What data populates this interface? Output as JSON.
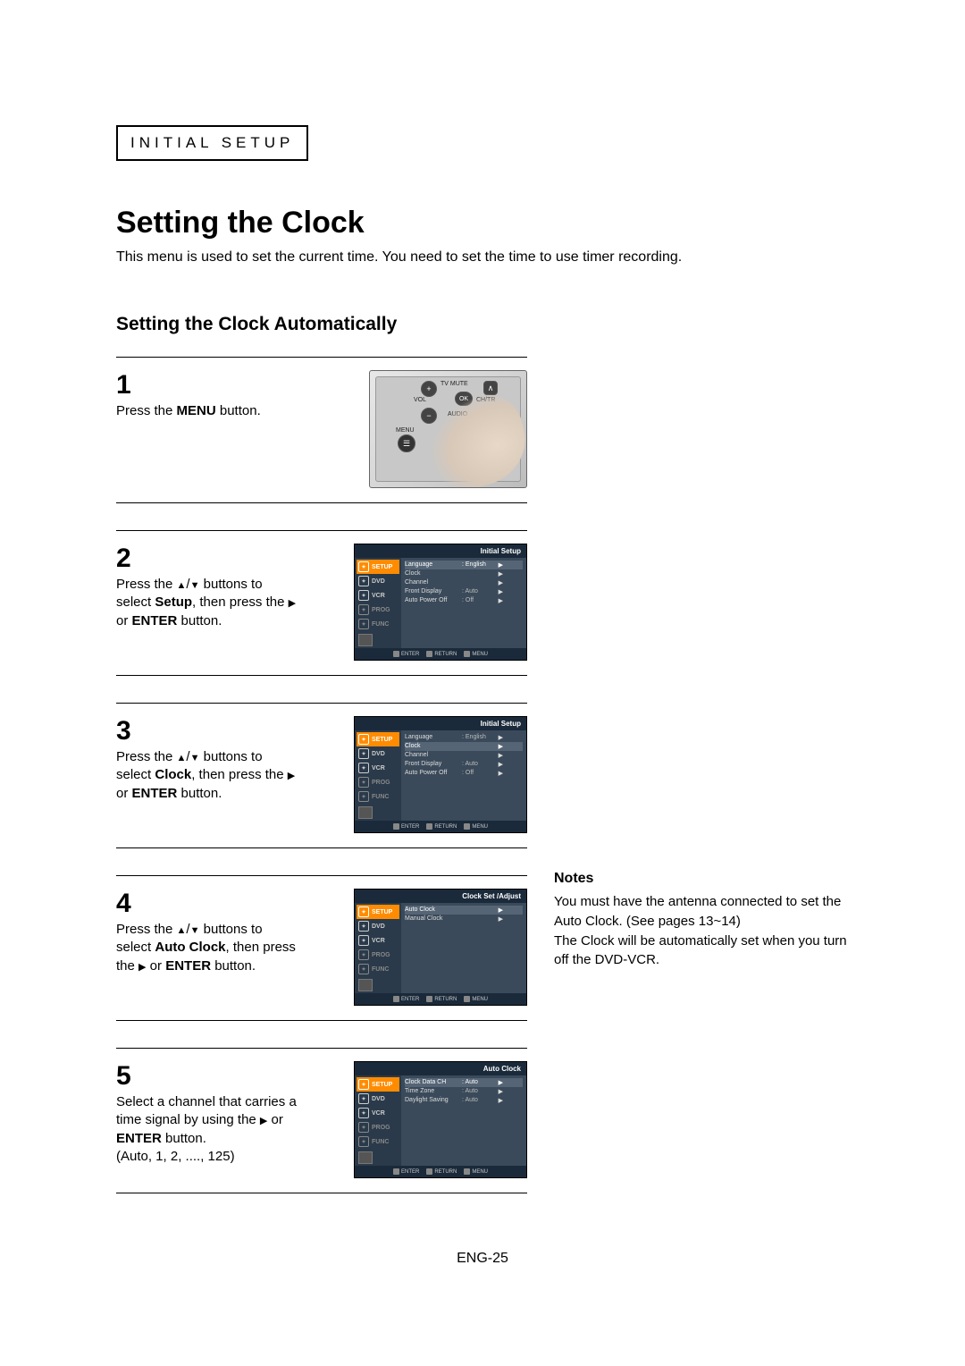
{
  "section_label": "INITIAL SETUP",
  "main_title": "Setting the Clock",
  "intro": "This menu is used to set the current time. You need to set the time to use timer recording.",
  "sub_title": "Setting the Clock Automatically",
  "steps": {
    "s1": {
      "num": "1",
      "text_before": "Press the ",
      "bold": "MENU",
      "text_after": " button."
    },
    "s2": {
      "num": "2",
      "line1_a": "Press the ",
      "line1_b": " buttons to",
      "line2_a": "select ",
      "line2_bold": "Setup",
      "line2_b": ", then press the ",
      "line3_a": "or ",
      "line3_bold": "ENTER",
      "line3_b": " button."
    },
    "s3": {
      "num": "3",
      "line1_a": "Press the ",
      "line1_b": " buttons to",
      "line2_a": "select ",
      "line2_bold": "Clock",
      "line2_b": ", then press the ",
      "line3_a": "or ",
      "line3_bold": "ENTER",
      "line3_b": " button."
    },
    "s4": {
      "num": "4",
      "line1_a": "Press the ",
      "line1_b": " buttons to",
      "line2_a": "select ",
      "line2_bold": "Auto Clock",
      "line2_b": ", then press",
      "line3_a": "the ",
      "line3_b": " or ",
      "line3_bold": "ENTER",
      "line3_c": " button."
    },
    "s5": {
      "num": "5",
      "line1": "Select a channel that carries a",
      "line2_a": "time signal by using the ",
      "line2_b": " or",
      "line3_bold": "ENTER",
      "line3_b": " button.",
      "line4": "(Auto, 1, 2, ...., 125)"
    }
  },
  "remote_labels": {
    "tv_mute": "TV MUTE",
    "vol": "VOL",
    "ch": "CH/TR",
    "ok": "OK",
    "menu": "MENU",
    "audio": "AUDIO"
  },
  "osd": {
    "side": [
      "SETUP",
      "DVD",
      "VCR",
      "PROG",
      "FUNC"
    ],
    "side_title_icon": "title-icon",
    "footer": {
      "enter": "ENTER",
      "return": "RETURN",
      "menu": "MENU"
    }
  },
  "osd2": {
    "header": "Initial Setup",
    "rows": [
      {
        "label": "Language",
        "val": ": English",
        "hl": true
      },
      {
        "label": "Clock",
        "val": "",
        "hl": false
      },
      {
        "label": "Channel",
        "val": "",
        "hl": false
      },
      {
        "label": "Front Display",
        "val": ": Auto",
        "hl": false
      },
      {
        "label": "Auto Power Off",
        "val": ": Off",
        "hl": false
      }
    ]
  },
  "osd3": {
    "header": "Initial Setup",
    "rows": [
      {
        "label": "Language",
        "val": ": English",
        "hl": false
      },
      {
        "label": "Clock",
        "val": "",
        "hl": true
      },
      {
        "label": "Channel",
        "val": "",
        "hl": false
      },
      {
        "label": "Front Display",
        "val": ": Auto",
        "hl": false
      },
      {
        "label": "Auto Power Off",
        "val": ": Off",
        "hl": false
      }
    ]
  },
  "osd4": {
    "header": "Clock Set /Adjust",
    "rows": [
      {
        "label": "Auto Clock",
        "val": "",
        "hl": true
      },
      {
        "label": "Manual Clock",
        "val": "",
        "hl": false
      }
    ]
  },
  "osd5": {
    "header": "Auto Clock",
    "rows": [
      {
        "label": "Clock Data CH",
        "val": ": Auto",
        "hl": true
      },
      {
        "label": "Time Zone",
        "val": ": Auto",
        "hl": false
      },
      {
        "label": "Daylight Saving",
        "val": ": Auto",
        "hl": false
      }
    ]
  },
  "notes": {
    "heading": "Notes",
    "p1": "You must have the antenna connected to set the Auto Clock. (See pages 13~14)",
    "p2": "The Clock will be automatically set when you turn off the DVD-VCR."
  },
  "page_number": "ENG-25"
}
